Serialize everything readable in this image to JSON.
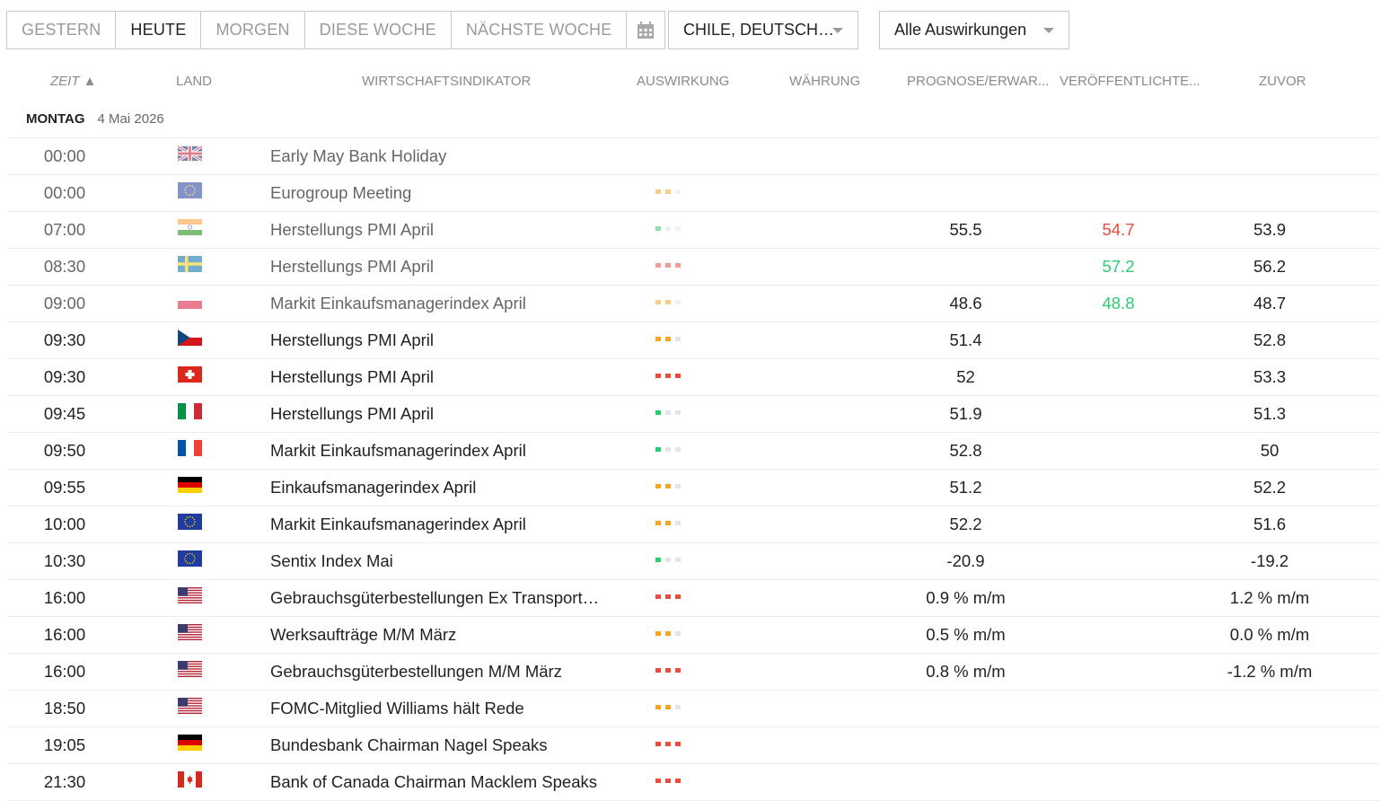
{
  "tabs": [
    {
      "label": "GESTERN",
      "active": false
    },
    {
      "label": "HEUTE",
      "active": true
    },
    {
      "label": "MORGEN",
      "active": false
    },
    {
      "label": "DIESE WOCHE",
      "active": false
    },
    {
      "label": "NÄCHSTE WOCHE",
      "active": false
    }
  ],
  "country_filter": {
    "label": "CHILE, DEUTSCH…"
  },
  "impact_filter": {
    "label": "Alle Auswirkungen"
  },
  "columns": {
    "time": "ZEIT ▲",
    "country": "LAND",
    "indicator": "WIRTSCHAFTSINDIKATOR",
    "impact": "AUSWIRKUNG",
    "currency": "WÄHRUNG",
    "forecast": "PROGNOSE/ERWAR...",
    "actual": "VERÖFFENTLICHTE...",
    "previous": "ZUVOR"
  },
  "day": {
    "weekday": "MONTAG",
    "date": "4 Mai 2026"
  },
  "impact_colors": {
    "low": "#2ecc71",
    "medium": "#f5a623",
    "high": "#e74c3c",
    "empty": "#e4e4e4"
  },
  "rows": [
    {
      "time": "00:00",
      "flag": "uk",
      "name": "Early May Bank Holiday",
      "impact": "none",
      "forecast": "",
      "actual": "",
      "actual_dir": "",
      "previous": "",
      "past": true,
      "faded": true
    },
    {
      "time": "00:00",
      "flag": "eu",
      "name": "Eurogroup Meeting",
      "impact": "medium",
      "forecast": "",
      "actual": "",
      "actual_dir": "",
      "previous": "",
      "past": true,
      "faded": true
    },
    {
      "time": "07:00",
      "flag": "in",
      "name": "Herstellungs PMI April",
      "impact": "low",
      "forecast": "55.5",
      "actual": "54.7",
      "actual_dir": "down",
      "previous": "53.9",
      "past": true,
      "faded": true
    },
    {
      "time": "08:30",
      "flag": "se",
      "name": "Herstellungs PMI April",
      "impact": "high",
      "forecast": "",
      "actual": "57.2",
      "actual_dir": "up",
      "previous": "56.2",
      "past": true,
      "faded": true
    },
    {
      "time": "09:00",
      "flag": "pl",
      "name": "Markit Einkaufsmanagerindex April",
      "impact": "medium",
      "forecast": "48.6",
      "actual": "48.8",
      "actual_dir": "up",
      "previous": "48.7",
      "past": true,
      "faded": true
    },
    {
      "time": "09:30",
      "flag": "cz",
      "name": "Herstellungs PMI April",
      "impact": "medium",
      "forecast": "51.4",
      "actual": "",
      "actual_dir": "",
      "previous": "52.8",
      "past": false,
      "faded": false
    },
    {
      "time": "09:30",
      "flag": "ch",
      "name": "Herstellungs PMI April",
      "impact": "high",
      "forecast": "52",
      "actual": "",
      "actual_dir": "",
      "previous": "53.3",
      "past": false,
      "faded": false
    },
    {
      "time": "09:45",
      "flag": "it",
      "name": "Herstellungs PMI April",
      "impact": "low",
      "forecast": "51.9",
      "actual": "",
      "actual_dir": "",
      "previous": "51.3",
      "past": false,
      "faded": false
    },
    {
      "time": "09:50",
      "flag": "fr",
      "name": "Markit Einkaufsmanagerindex April",
      "impact": "low",
      "forecast": "52.8",
      "actual": "",
      "actual_dir": "",
      "previous": "50",
      "past": false,
      "faded": false
    },
    {
      "time": "09:55",
      "flag": "de",
      "name": "Einkaufsmanagerindex April",
      "impact": "medium",
      "forecast": "51.2",
      "actual": "",
      "actual_dir": "",
      "previous": "52.2",
      "past": false,
      "faded": false
    },
    {
      "time": "10:00",
      "flag": "eu",
      "name": "Markit Einkaufsmanagerindex April",
      "impact": "medium",
      "forecast": "52.2",
      "actual": "",
      "actual_dir": "",
      "previous": "51.6",
      "past": false,
      "faded": false
    },
    {
      "time": "10:30",
      "flag": "eu",
      "name": "Sentix Index Mai",
      "impact": "low",
      "forecast": "-20.9",
      "actual": "",
      "actual_dir": "",
      "previous": "-19.2",
      "past": false,
      "faded": false
    },
    {
      "time": "16:00",
      "flag": "us",
      "name": "Gebrauchsgüterbestellungen Ex Transport…",
      "impact": "high",
      "forecast": "0.9 % m/m",
      "actual": "",
      "actual_dir": "",
      "previous": "1.2 % m/m",
      "past": false,
      "faded": false
    },
    {
      "time": "16:00",
      "flag": "us",
      "name": "Werksaufträge M/M März",
      "impact": "medium",
      "forecast": "0.5 % m/m",
      "actual": "",
      "actual_dir": "",
      "previous": "0.0 % m/m",
      "past": false,
      "faded": false
    },
    {
      "time": "16:00",
      "flag": "us",
      "name": "Gebrauchsgüterbestellungen M/M März",
      "impact": "high",
      "forecast": "0.8 % m/m",
      "actual": "",
      "actual_dir": "",
      "previous": "-1.2 % m/m",
      "past": false,
      "faded": false
    },
    {
      "time": "18:50",
      "flag": "us",
      "name": "FOMC-Mitglied Williams hält Rede",
      "impact": "medium",
      "forecast": "",
      "actual": "",
      "actual_dir": "",
      "previous": "",
      "past": false,
      "faded": false
    },
    {
      "time": "19:05",
      "flag": "de",
      "name": "Bundesbank Chairman Nagel Speaks",
      "impact": "high",
      "forecast": "",
      "actual": "",
      "actual_dir": "",
      "previous": "",
      "past": false,
      "faded": false
    },
    {
      "time": "21:30",
      "flag": "ca",
      "name": "Bank of Canada Chairman Macklem Speaks",
      "impact": "high",
      "forecast": "",
      "actual": "",
      "actual_dir": "",
      "previous": "",
      "past": false,
      "faded": false
    }
  ]
}
